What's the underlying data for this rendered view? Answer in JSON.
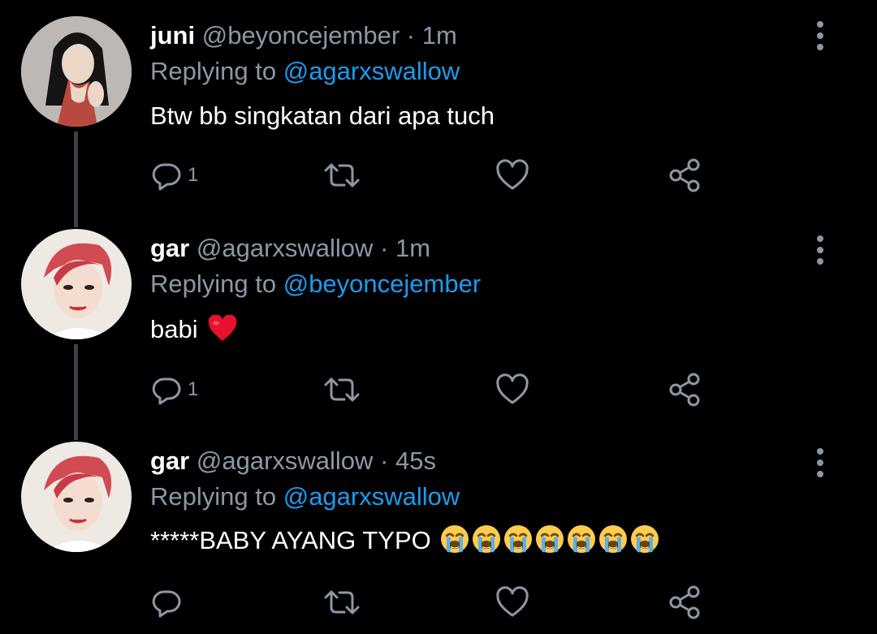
{
  "colors": {
    "background": "#000000",
    "name": "#ffffff",
    "meta": "#8b98a5",
    "mention": "#1d9bf0",
    "icon": "#8b98a5",
    "thread_line": "#3d4145"
  },
  "tweets": [
    {
      "name": "juni",
      "handle": "@beyoncejember",
      "time": "1m",
      "replying_prefix": "Replying to",
      "replying_to": "@agarxswallow",
      "text": "Btw bb singkatan dari apa tuch",
      "emojis": [],
      "reply_count": "1",
      "icons": [
        "reply-icon",
        "retweet-icon",
        "like-icon",
        "share-icon",
        "more-icon"
      ]
    },
    {
      "name": "gar",
      "handle": "@agarxswallow",
      "time": "1m",
      "replying_prefix": "Replying to",
      "replying_to": "@beyoncejember",
      "text": "babi",
      "emojis": [
        "red-heart"
      ],
      "reply_count": "1",
      "icons": [
        "reply-icon",
        "retweet-icon",
        "like-icon",
        "share-icon",
        "more-icon"
      ]
    },
    {
      "name": "gar",
      "handle": "@agarxswallow",
      "time": "45s",
      "replying_prefix": "Replying to",
      "replying_to": "@agarxswallow",
      "text": "*****BABY AYANG TYPO",
      "emojis": [
        "loudly-crying-face",
        "loudly-crying-face",
        "loudly-crying-face",
        "loudly-crying-face",
        "loudly-crying-face",
        "loudly-crying-face",
        "loudly-crying-face"
      ],
      "reply_count": "",
      "icons": [
        "reply-icon",
        "retweet-icon",
        "like-icon",
        "share-icon",
        "more-icon"
      ]
    }
  ]
}
